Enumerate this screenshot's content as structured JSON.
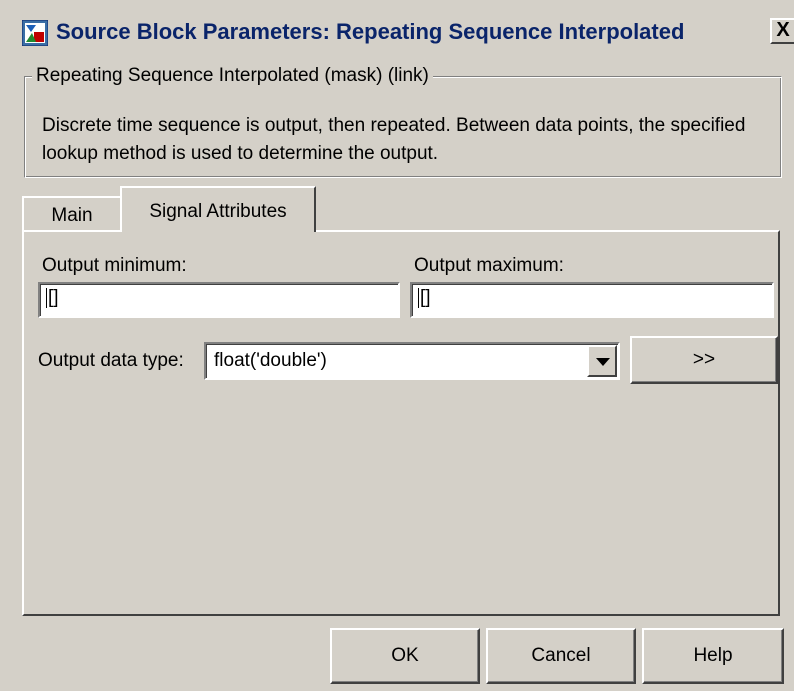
{
  "window": {
    "title": "Source Block Parameters: Repeating Sequence Interpolated",
    "close_label": "X"
  },
  "mask": {
    "legend": "Repeating Sequence Interpolated (mask) (link)",
    "description": "Discrete time sequence is output, then repeated.  Between data points, the specified lookup method is used to determine the output."
  },
  "tabs": [
    {
      "label": "Main",
      "active": false
    },
    {
      "label": "Signal Attributes",
      "active": true
    }
  ],
  "fields": {
    "output_minimum": {
      "label": "Output minimum:",
      "value": "[]"
    },
    "output_maximum": {
      "label": "Output maximum:",
      "value": "[]"
    },
    "output_data_type": {
      "label": "Output data type:",
      "value": "float('double')"
    },
    "data_type_assistant_label": ">>"
  },
  "buttons": {
    "ok": "OK",
    "cancel": "Cancel",
    "help": "Help"
  },
  "icons": {
    "title": "simulink-block-icon",
    "dropdown": "chevron-down-icon"
  },
  "colors": {
    "title_text": "#0a246a",
    "dialog_bg": "#d4d0c8"
  }
}
